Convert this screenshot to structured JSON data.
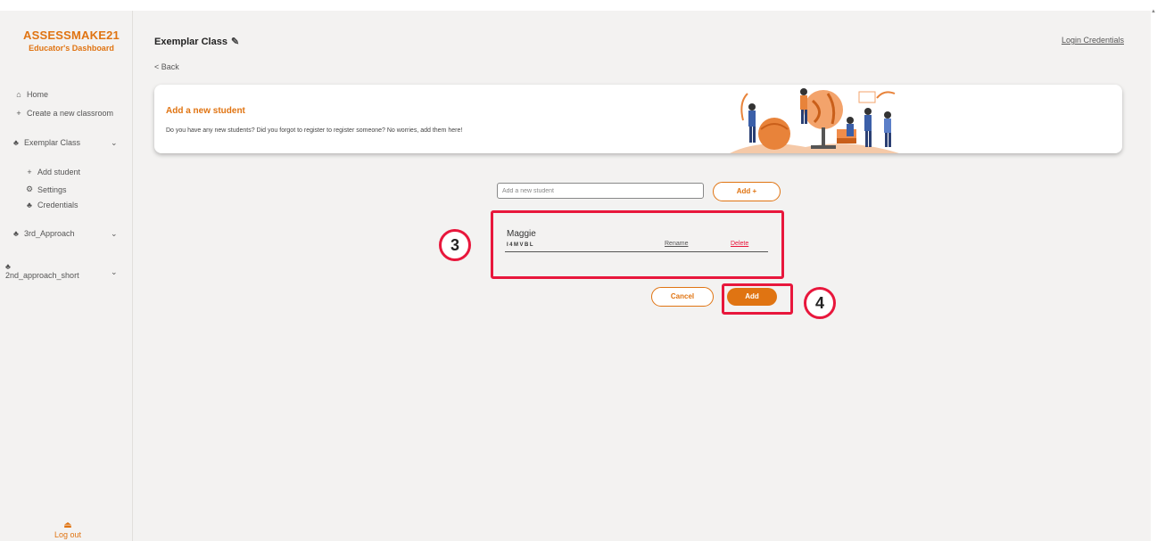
{
  "brand": {
    "title": "ASSESSMAKE21",
    "subtitle": "Educator's Dashboard"
  },
  "sidebar": {
    "items": [
      {
        "label": "Home",
        "icon": "home-icon"
      },
      {
        "label": "Create a new classroom",
        "icon": "plus-icon"
      },
      {
        "label": "Exemplar Class",
        "icon": "group-icon"
      },
      {
        "label": "Add student",
        "icon": "plus-icon"
      },
      {
        "label": "Settings",
        "icon": "gear-icon"
      },
      {
        "label": "Credentials",
        "icon": "group-icon"
      },
      {
        "label": "3rd_Approach",
        "icon": "group-icon"
      },
      {
        "label": "2nd_approach_short",
        "icon": "group-icon"
      }
    ],
    "logout_label": "Log out"
  },
  "header": {
    "class_title": "Exemplar Class",
    "back_label": "< Back",
    "login_credentials_label": "Login Credentials"
  },
  "banner": {
    "title": "Add a new student",
    "description": "Do you have any new students? Did you forgot to register to register someone? No worries, add them here!"
  },
  "form": {
    "input_placeholder": "Add a new student",
    "add_plus_label": "Add +"
  },
  "students": [
    {
      "name": "Maggie",
      "code": "I4MVBL",
      "rename_label": "Rename",
      "delete_label": "Delete"
    }
  ],
  "actions": {
    "cancel_label": "Cancel",
    "add_label": "Add"
  },
  "annotations": {
    "step3": "3",
    "step4": "4"
  },
  "colors": {
    "accent": "#e07412",
    "highlight": "#e8173c",
    "background": "#f3f2f1"
  }
}
